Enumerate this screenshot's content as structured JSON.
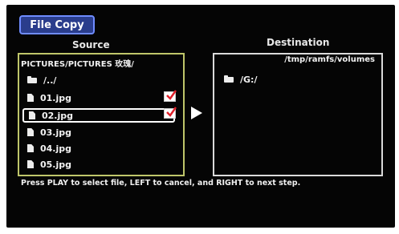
{
  "title_button": "File Copy",
  "source": {
    "label": "Source",
    "path": "PICTURES/PICTURES 玫瑰/",
    "items": [
      {
        "name": "/../",
        "type": "folder",
        "checked": false
      },
      {
        "name": "01.jpg",
        "type": "file",
        "checked": true
      },
      {
        "name": "02.jpg",
        "type": "file",
        "checked": true,
        "selected": true
      },
      {
        "name": "03.jpg",
        "type": "file",
        "checked": false
      },
      {
        "name": "04.jpg",
        "type": "file",
        "checked": false
      },
      {
        "name": "05.jpg",
        "type": "file",
        "checked": false
      }
    ]
  },
  "destination": {
    "label": "Destination",
    "path": "/tmp/ramfs/volumes",
    "items": [
      {
        "name": "/G:/",
        "type": "folder"
      }
    ]
  },
  "help_text": "Press PLAY to select file, LEFT to cancel, and RIGHT to next step.",
  "colors": {
    "background": "#050505",
    "title_button_fill": "#2a3d8c",
    "title_button_border": "#6f8cff",
    "source_border": "#bfc66a",
    "checkmark": "#e0202a"
  }
}
